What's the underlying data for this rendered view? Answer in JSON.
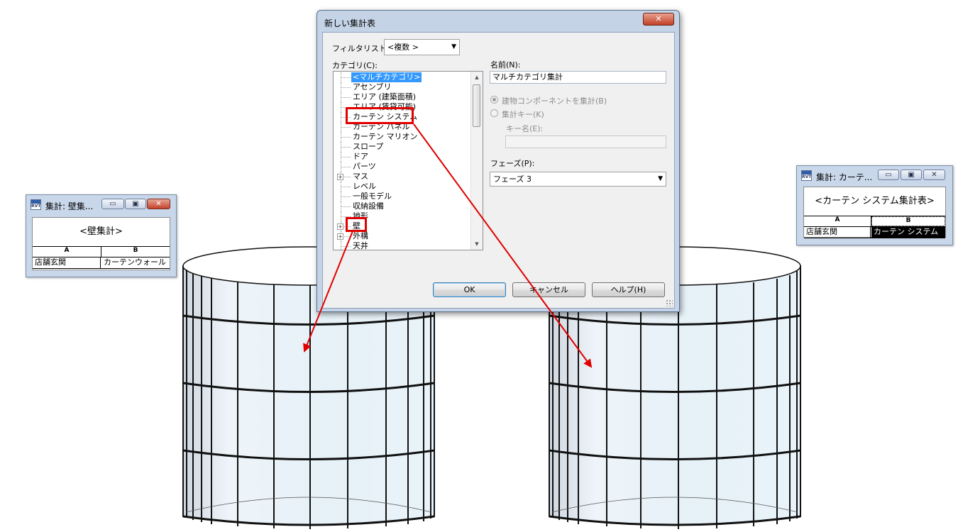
{
  "scene": {
    "wall_color": "#eaf3f9",
    "mullion_color": "#111111",
    "annotation_color": "#e00000"
  },
  "wall_schedule": {
    "title": "集計: 壁集...",
    "header_text": "<壁集計>",
    "columns": [
      "A",
      "B"
    ],
    "rows": [
      [
        "店舗玄関",
        "カーテンウォール"
      ]
    ],
    "buttons": {
      "minimize": "▭",
      "restore": "▣",
      "close": "✕"
    }
  },
  "curtain_schedule": {
    "title": "集計: カーテ...",
    "header_text": "<カーテン システム集計表>",
    "columns": [
      "A",
      "B"
    ],
    "rows": [
      [
        "店舗玄関",
        "カーテン システム"
      ]
    ],
    "buttons": {
      "minimize": "▭",
      "restore": "▣",
      "close": "✕"
    }
  },
  "dialog": {
    "title": "新しい集計表",
    "close_label": "✕",
    "filter_label": "フィルタリスト:",
    "filter_value": "<複数 >",
    "category_label": "カテゴリ(C):",
    "categories": [
      {
        "label": "<マルチカテゴリ>",
        "selected": true,
        "expandable": false
      },
      {
        "label": "アセンブリ",
        "selected": false,
        "expandable": false
      },
      {
        "label": "エリア (建築面積)",
        "selected": false,
        "expandable": false
      },
      {
        "label": "エリア (賃貸可能)",
        "selected": false,
        "expandable": false
      },
      {
        "label": "カーテン システム",
        "selected": false,
        "expandable": false
      },
      {
        "label": "カーテン パネル",
        "selected": false,
        "expandable": false
      },
      {
        "label": "カーテン マリオン",
        "selected": false,
        "expandable": false
      },
      {
        "label": "スロープ",
        "selected": false,
        "expandable": false
      },
      {
        "label": "ドア",
        "selected": false,
        "expandable": false
      },
      {
        "label": "パーツ",
        "selected": false,
        "expandable": false
      },
      {
        "label": "マス",
        "selected": false,
        "expandable": true
      },
      {
        "label": "レベル",
        "selected": false,
        "expandable": false
      },
      {
        "label": "一般モデル",
        "selected": false,
        "expandable": false
      },
      {
        "label": "収納設備",
        "selected": false,
        "expandable": false
      },
      {
        "label": "地形",
        "selected": false,
        "expandable": false
      },
      {
        "label": "壁",
        "selected": false,
        "expandable": true
      },
      {
        "label": "外構",
        "selected": false,
        "expandable": true
      },
      {
        "label": "天井",
        "selected": false,
        "expandable": false
      }
    ],
    "name_label": "名前(N):",
    "name_value": "マルチカテゴリ集計",
    "radio_building": "建物コンポーネントを集計(B)",
    "radio_key": "集計キー(K)",
    "key_name_label": "キー名(E):",
    "key_name_value": "",
    "phase_label": "フェーズ(P):",
    "phase_value": "フェーズ 3",
    "ok_label": "OK",
    "cancel_label": "キャンセル",
    "help_label": "ヘルプ(H)"
  }
}
